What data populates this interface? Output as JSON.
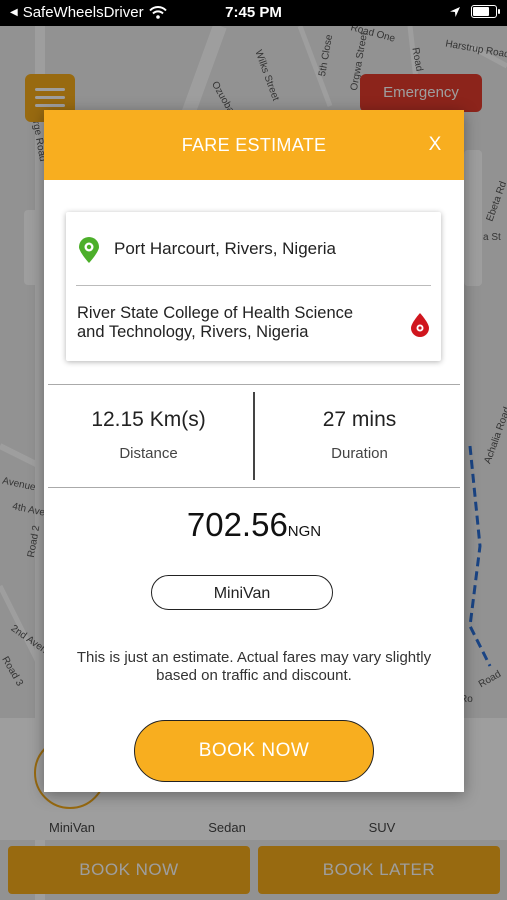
{
  "status_bar": {
    "back_label": "SafeWheelsDriver",
    "time": "7:45 PM",
    "battery_level": 0.8
  },
  "map": {
    "streets": [
      "Ada-George Road",
      "Wilks Street",
      "Ozuoba",
      "5th Close",
      "Orgwa Street",
      "Road One",
      "Harstrup Road",
      "Road",
      "Ebeta Rd",
      "a St",
      "Avenue",
      "4th Aven",
      "Road 2",
      "Road 3",
      "2nd Aven",
      "Achalia Road",
      "Road",
      "Ro"
    ]
  },
  "background": {
    "emergency_label": "Emergency",
    "vehicles": [
      {
        "label": "MiniVan"
      },
      {
        "label": "Sedan"
      },
      {
        "label": "SUV"
      }
    ],
    "book_now_label": "BOOK NOW",
    "book_later_label": "BOOK LATER"
  },
  "modal": {
    "title": "FARE ESTIMATE",
    "close_label": "X",
    "pickup": "Port Harcourt, Rivers, Nigeria",
    "dropoff": "River State College of Health Science and Technology, Rivers, Nigeria",
    "distance_value": "12.15 Km(s)",
    "distance_label": "Distance",
    "duration_value": "27 mins",
    "duration_label": "Duration",
    "fare_amount": "702.56",
    "fare_currency": "NGN",
    "vehicle_type": "MiniVan",
    "note": "This is just an estimate. Actual fares may vary slightly based on traffic and discount.",
    "book_now_label": "BOOK NOW"
  },
  "colors": {
    "accent": "#f8ae1f",
    "emergency": "#e23b2c",
    "pickup_pin": "#4caf2a",
    "dropoff_pin": "#d0161e"
  }
}
